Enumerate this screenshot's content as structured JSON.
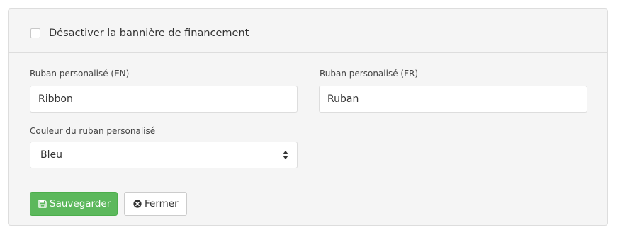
{
  "banner": {
    "disable_label": "Désactiver la bannière de financement",
    "disable_checked": false
  },
  "fields": {
    "ribbon_en": {
      "label": "Ruban personalisé (EN)",
      "value": "Ribbon"
    },
    "ribbon_fr": {
      "label": "Ruban personalisé (FR)",
      "value": "Ruban"
    },
    "ribbon_color": {
      "label": "Couleur du ruban personalisé",
      "value": "Bleu"
    }
  },
  "actions": {
    "save_label": "Sauvegarder",
    "close_label": "Fermer"
  },
  "colors": {
    "save_button": "#5cb85c",
    "panel_background": "#f5f5f5",
    "border": "#dddddd"
  },
  "icons": {
    "save": "floppy-disk-icon",
    "close": "times-circle-icon",
    "select": "sort-arrows-icon"
  }
}
